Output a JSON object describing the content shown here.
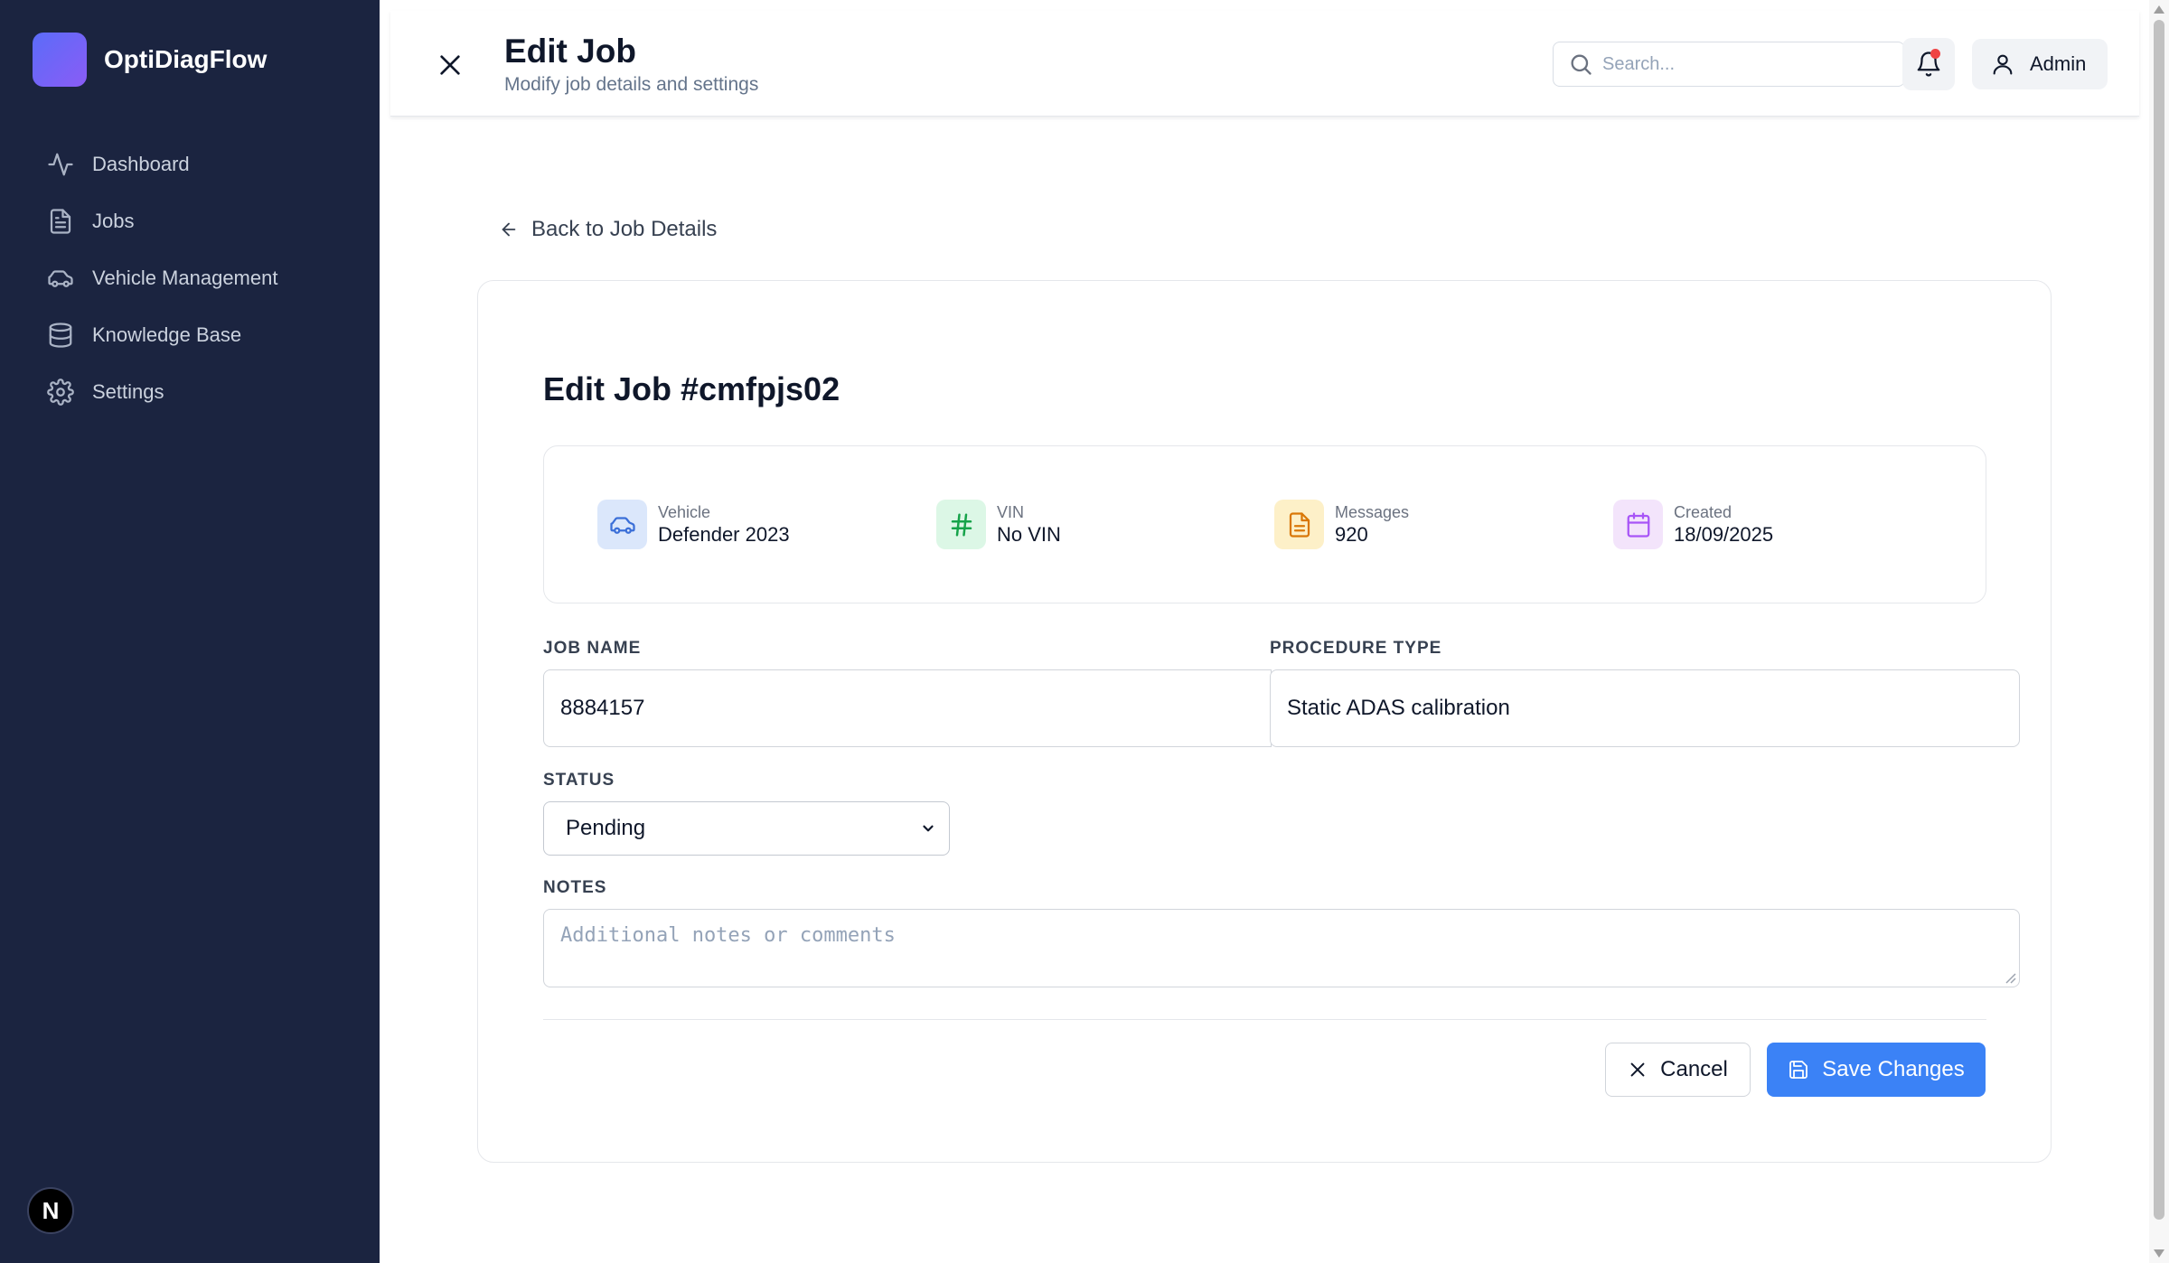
{
  "app": {
    "name": "OptiDiagFlow",
    "corner_badge": "N"
  },
  "sidebar": {
    "items": [
      {
        "label": "Dashboard",
        "icon": "activity-icon"
      },
      {
        "label": "Jobs",
        "icon": "file-text-icon"
      },
      {
        "label": "Vehicle Management",
        "icon": "car-icon"
      },
      {
        "label": "Knowledge Base",
        "icon": "database-icon"
      },
      {
        "label": "Settings",
        "icon": "gear-icon"
      }
    ]
  },
  "header": {
    "title": "Edit Job",
    "subtitle": "Modify job details and settings",
    "search_placeholder": "Search...",
    "user_label": "Admin"
  },
  "page": {
    "back_label": "Back to Job Details",
    "title": "Edit Job #cmfpjs02"
  },
  "info": {
    "vehicle": {
      "label": "Vehicle",
      "value": "Defender 2023"
    },
    "vin": {
      "label": "VIN",
      "value": "No VIN"
    },
    "messages": {
      "label": "Messages",
      "value": "920"
    },
    "created": {
      "label": "Created",
      "value": "18/09/2025"
    }
  },
  "form": {
    "job_name_label": "JOB NAME",
    "job_name_value": "8884157",
    "procedure_type_label": "PROCEDURE TYPE",
    "procedure_type_value": "Static ADAS calibration",
    "status_label": "STATUS",
    "status_value": "Pending",
    "notes_label": "NOTES",
    "notes_placeholder": "Additional notes or comments"
  },
  "actions": {
    "cancel_label": "Cancel",
    "save_label": "Save Changes"
  },
  "colors": {
    "sidebar_bg": "#1b2440",
    "primary": "#3b82f6",
    "notification_dot": "#ef4444",
    "vehicle_icon_bg": "#dbe7fb",
    "vin_icon_bg": "#dcf7e6",
    "messages_icon_bg": "#fdf0c8",
    "created_icon_bg": "#f3e4fb"
  }
}
